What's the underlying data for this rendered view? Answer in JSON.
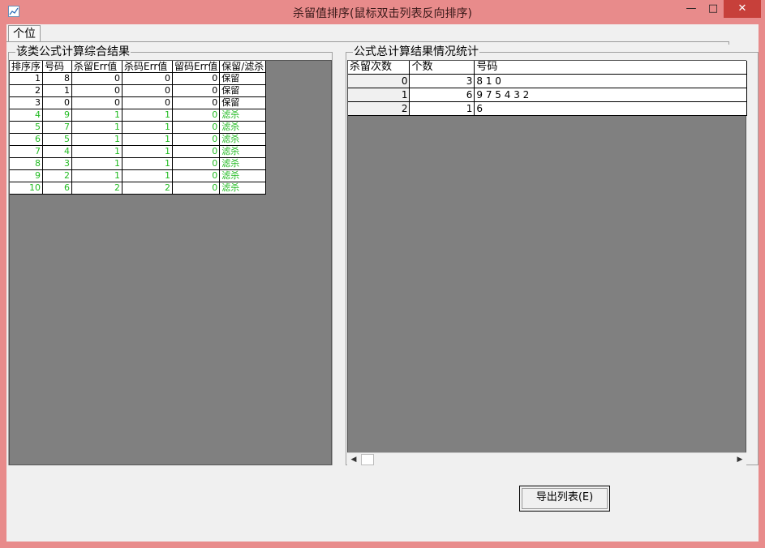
{
  "window": {
    "title": "杀留值排序(鼠标双击列表反向排序)",
    "min_glyph": "—",
    "max_glyph": "□",
    "close_glyph": "✕"
  },
  "tabs": [
    {
      "label": "个位"
    }
  ],
  "left_group": {
    "title": "该类公式计算综合结果",
    "columns": [
      "排序序",
      "号码",
      "杀留Err值",
      "杀码Err值",
      "留码Err值",
      "保留/滤杀"
    ],
    "rows": [
      {
        "rank": "1",
        "num": "8",
        "kl": "0",
        "km": "0",
        "lm": "0",
        "status": "保留"
      },
      {
        "rank": "2",
        "num": "1",
        "kl": "0",
        "km": "0",
        "lm": "0",
        "status": "保留"
      },
      {
        "rank": "3",
        "num": "0",
        "kl": "0",
        "km": "0",
        "lm": "0",
        "status": "保留"
      },
      {
        "rank": "4",
        "num": "9",
        "kl": "1",
        "km": "1",
        "lm": "0",
        "status": "滤杀"
      },
      {
        "rank": "5",
        "num": "7",
        "kl": "1",
        "km": "1",
        "lm": "0",
        "status": "滤杀"
      },
      {
        "rank": "6",
        "num": "5",
        "kl": "1",
        "km": "1",
        "lm": "0",
        "status": "滤杀"
      },
      {
        "rank": "7",
        "num": "4",
        "kl": "1",
        "km": "1",
        "lm": "0",
        "status": "滤杀"
      },
      {
        "rank": "8",
        "num": "3",
        "kl": "1",
        "km": "1",
        "lm": "0",
        "status": "滤杀"
      },
      {
        "rank": "9",
        "num": "2",
        "kl": "1",
        "km": "1",
        "lm": "0",
        "status": "滤杀"
      },
      {
        "rank": "10",
        "num": "6",
        "kl": "2",
        "km": "2",
        "lm": "0",
        "status": "滤杀"
      }
    ]
  },
  "right_group": {
    "title": "公式总计算结果情况统计",
    "columns": [
      "杀留次数",
      "个数",
      "号码"
    ],
    "rows": [
      {
        "times": "0",
        "count": "3",
        "nums": "8 1 0"
      },
      {
        "times": "1",
        "count": "6",
        "nums": "9 7 5 4 3 2"
      },
      {
        "times": "2",
        "count": "1",
        "nums": "6"
      }
    ]
  },
  "export_button": {
    "label": "导出列表(E)"
  },
  "colors": {
    "titlebar": "#e88b8b",
    "close": "#c7403a",
    "filtered_text": "#22bb22",
    "grid_bg": "#808080"
  }
}
